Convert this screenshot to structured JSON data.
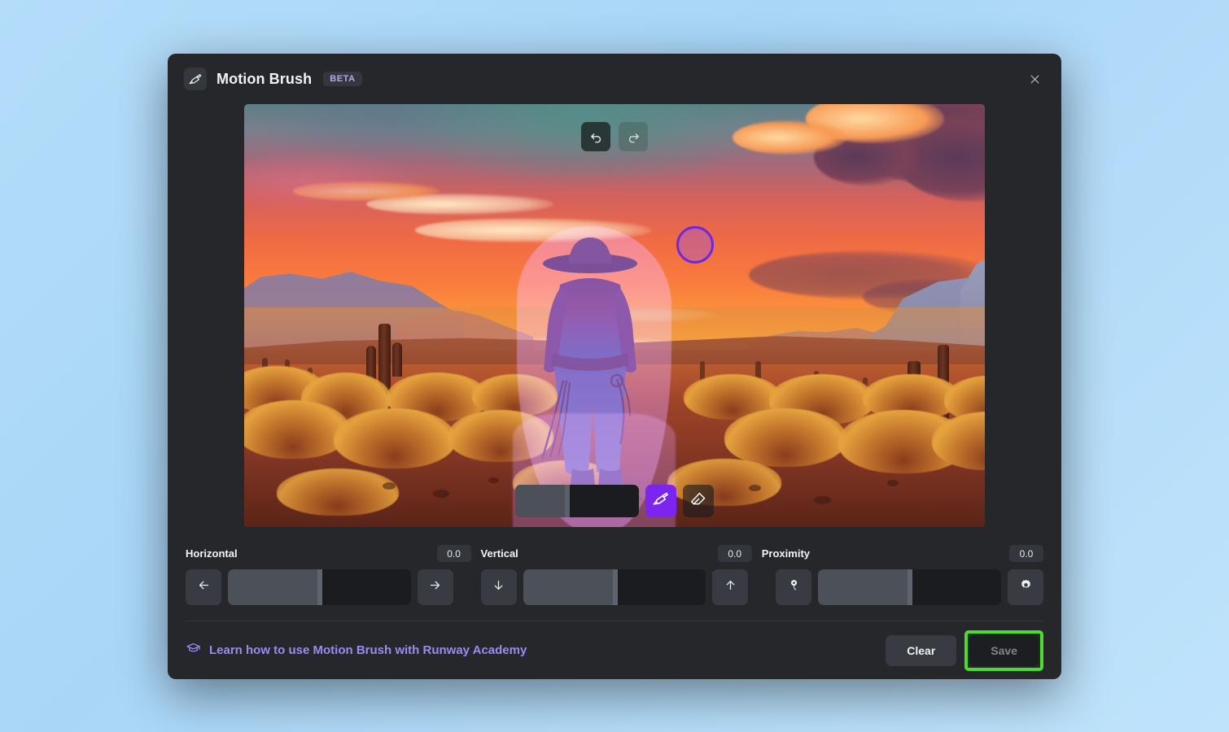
{
  "page": {
    "background_color": "#a9d6f7"
  },
  "modal": {
    "icon": "paint-brush-icon",
    "title": "Motion Brush",
    "badge": "BETA",
    "close_icon": "close-icon",
    "accent_color": "#7c24f0"
  },
  "canvas": {
    "history": {
      "undo_icon": "undo-icon",
      "undo_state": "enabled",
      "redo_icon": "redo-icon",
      "redo_state": "disabled"
    },
    "tools": {
      "brush_size_label": "brush-size-slider",
      "brush_size_percent": 40,
      "brush_icon": "paint-brush-icon",
      "brush_active": true,
      "eraser_icon": "eraser-icon",
      "eraser_active": false
    },
    "cursor": {
      "icon": "brush-cursor-circle",
      "color": "#6d28e0"
    },
    "image_description": "Cowboy walking into a desert sunset with mesas and cacti",
    "mask_color": "#ab6ade"
  },
  "params": [
    {
      "label": "Horizontal",
      "value": "0.0",
      "dec_icon": "arrow-left-icon",
      "inc_icon": "arrow-right-icon",
      "slider_percent": 49
    },
    {
      "label": "Vertical",
      "value": "0.0",
      "dec_icon": "arrow-down-icon",
      "inc_icon": "arrow-up-icon",
      "slider_percent": 49
    },
    {
      "label": "Proximity",
      "value": "0.0",
      "dec_icon": "proximity-icon",
      "inc_icon": "gear-icon",
      "slider_percent": 49
    }
  ],
  "footer": {
    "academy_icon": "graduation-cap-icon",
    "academy_text": "Learn how to use Motion Brush with Runway Academy",
    "academy_color": "#9b8bf0",
    "clear_label": "Clear",
    "save_label": "Save",
    "save_disabled": true,
    "highlight_color": "#4ade28"
  }
}
